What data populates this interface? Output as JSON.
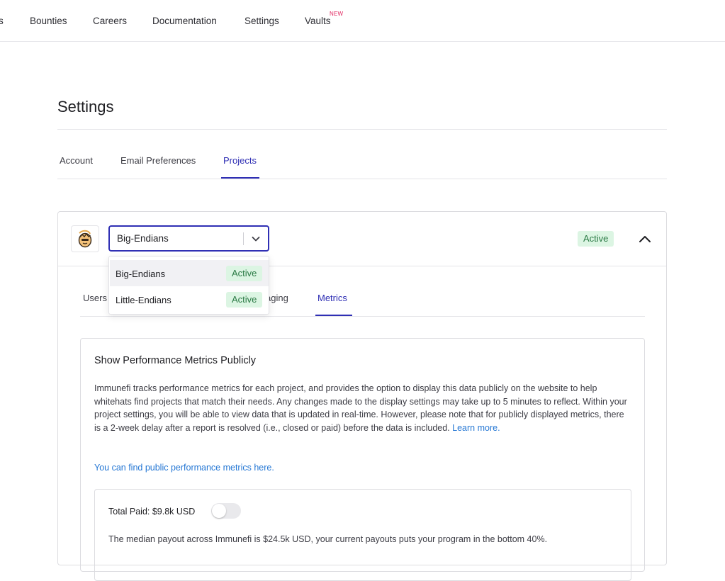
{
  "nav": {
    "items": [
      "s",
      "Bounties",
      "Careers",
      "Documentation",
      "Settings",
      "Vaults"
    ],
    "new_badge": "NEW"
  },
  "page": {
    "title": "Settings"
  },
  "settings_tabs": [
    "Account",
    "Email Preferences",
    "Projects"
  ],
  "project": {
    "selected": "Big-Endians",
    "status": "Active",
    "options": [
      {
        "name": "Big-Endians",
        "status": "Active"
      },
      {
        "name": "Little-Endians",
        "status": "Active"
      }
    ],
    "inner_tabs": [
      "Users",
      "aging",
      "Metrics"
    ]
  },
  "metrics": {
    "title": "Show Performance Metrics Publicly",
    "description": "Immunefi tracks performance metrics for each project, and provides the option to display this data publicly on the website to help whitehats find projects that match their needs. Any changes made to the display settings may take up to 5 minutes to reflect. Within your project settings, you will be able to view data that is updated in real-time. However, please note that for publicly displayed metrics, there is a 2-week delay after a report is resolved (i.e., closed or paid) before the data is included.",
    "learn_more": "Learn more.",
    "public_link": "You can find public performance metrics here.",
    "total_paid_label": "Total Paid: $9.8k USD",
    "total_paid_toggle_on": false,
    "median_text": "The median payout across Immunefi is $24.5k USD, your current payouts puts your program in the bottom 40%."
  },
  "colors": {
    "accent": "#2f2fb4",
    "link": "#2577d4",
    "badge_bg": "#dcf5e3",
    "badge_text": "#2a7a44",
    "new_badge": "#e0245e"
  }
}
